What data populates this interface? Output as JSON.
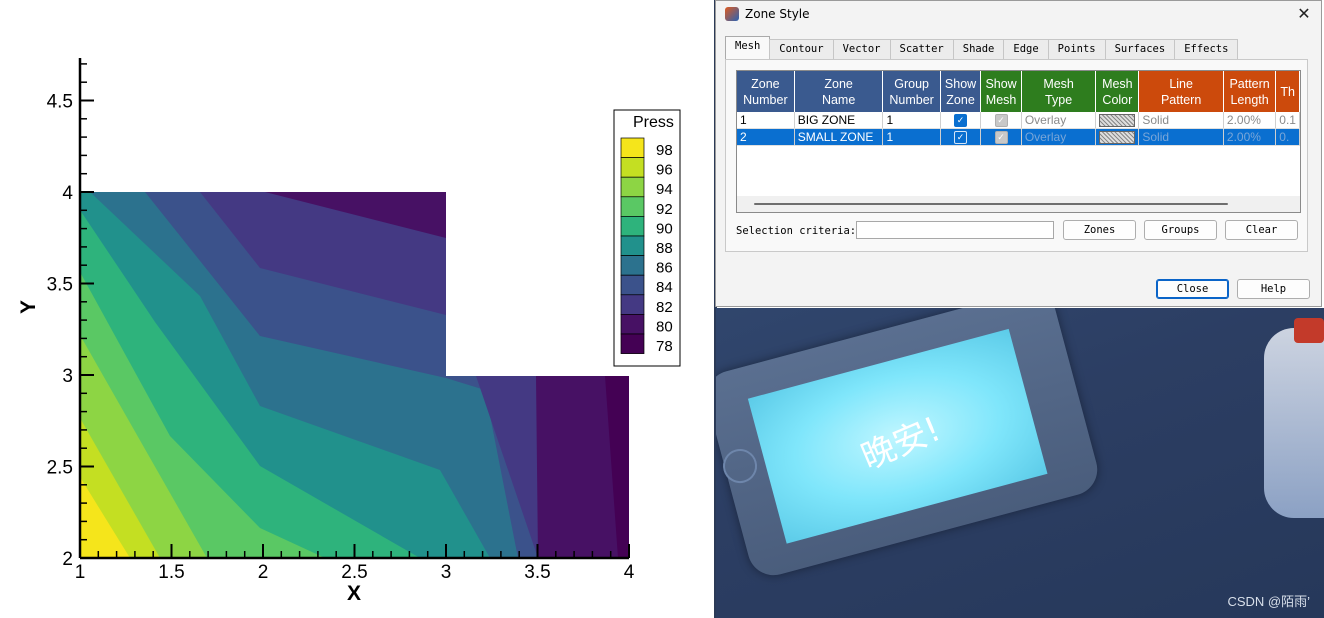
{
  "plot": {
    "xlabel": "X",
    "ylabel": "Y",
    "x_ticks": [
      "1",
      "1.5",
      "2",
      "2.5",
      "3",
      "3.5",
      "4"
    ],
    "y_ticks": [
      "2",
      "2.5",
      "3",
      "3.5",
      "4",
      "4.5"
    ],
    "legend_title": "Press",
    "legend_levels": [
      "98",
      "96",
      "94",
      "92",
      "90",
      "88",
      "86",
      "84",
      "82",
      "80",
      "78"
    ],
    "colors": [
      "#f5e51b",
      "#c4df22",
      "#8dd544",
      "#5ac864",
      "#2eb37c",
      "#21918c",
      "#2c728e",
      "#3b528b",
      "#443983",
      "#471164",
      "#440154"
    ]
  },
  "chart_data": {
    "type": "heatmap",
    "title": "",
    "xlabel": "X",
    "ylabel": "Y",
    "xlim": [
      1,
      4
    ],
    "ylim": [
      2,
      4.75
    ],
    "variable": "Press",
    "levels": [
      78,
      80,
      82,
      84,
      86,
      88,
      90,
      92,
      94,
      96,
      98
    ],
    "zones": [
      {
        "x": [
          1,
          3
        ],
        "y": [
          2,
          4
        ]
      },
      {
        "x": [
          3,
          4
        ],
        "y": [
          2,
          3
        ]
      }
    ]
  },
  "dialog": {
    "title": "Zone Style",
    "close_glyph": "✕",
    "tabs": [
      "Mesh",
      "Contour",
      "Vector",
      "Scatter",
      "Shade",
      "Edge",
      "Points",
      "Surfaces",
      "Effects"
    ],
    "columns": [
      {
        "label": [
          "Zone",
          "Number"
        ],
        "color": "blue"
      },
      {
        "label": [
          "Zone",
          "Name"
        ],
        "color": "blue"
      },
      {
        "label": [
          "Group",
          "Number"
        ],
        "color": "blue"
      },
      {
        "label": [
          "Show",
          "Zone"
        ],
        "color": "blue"
      },
      {
        "label": [
          "Show",
          "Mesh"
        ],
        "color": "green"
      },
      {
        "label": [
          "Mesh",
          "Type"
        ],
        "color": "green"
      },
      {
        "label": [
          "Mesh",
          "Color"
        ],
        "color": "green"
      },
      {
        "label": [
          "Line",
          "Pattern"
        ],
        "color": "orange"
      },
      {
        "label": [
          "Pattern",
          "Length"
        ],
        "color": "orange"
      },
      {
        "label": [
          "Th",
          ""
        ],
        "color": "orange"
      }
    ],
    "rows": [
      {
        "zone_number": "1",
        "zone_name": "BIG ZONE",
        "group": "1",
        "mesh_type": "Overlay",
        "line_pattern": "Solid",
        "pattern_length": "2.00%",
        "thickness": "0.1",
        "selected": false
      },
      {
        "zone_number": "2",
        "zone_name": "SMALL ZONE",
        "group": "1",
        "mesh_type": "Overlay",
        "line_pattern": "Solid",
        "pattern_length": "2.00%",
        "thickness": "0.",
        "selected": true
      }
    ],
    "selection_label": "Selection criteria:",
    "selection_value": "",
    "zones_button": "Zones",
    "groups_button": "Groups",
    "clear_button": "Clear",
    "close_button": "Close",
    "help_button": "Help"
  },
  "wallpaper": {
    "tablet_text": "晚安!",
    "watermark": "CSDN @陌雨’"
  }
}
